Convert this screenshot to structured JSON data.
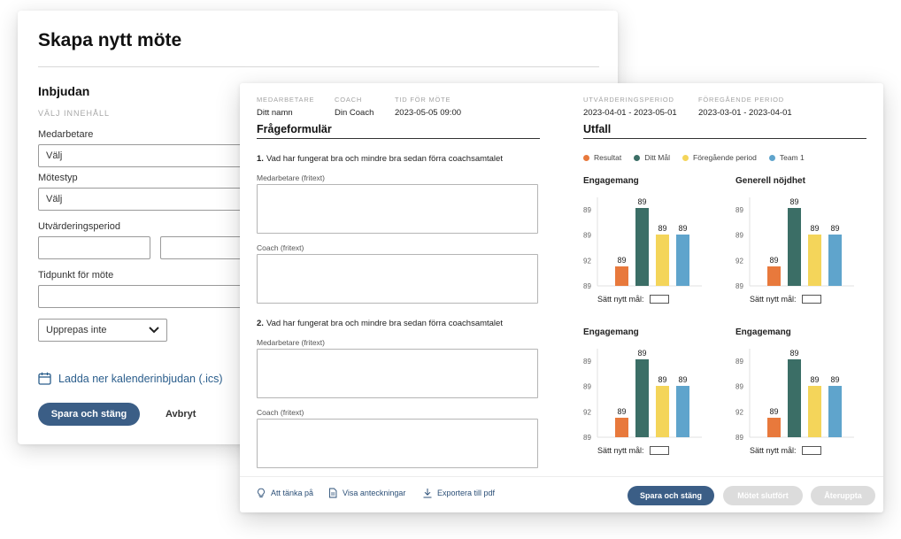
{
  "back_dialog": {
    "title": "Skapa nytt möte",
    "section_title": "Inbjudan",
    "section_caps": "VÄLJ INNEHÅLL",
    "fields": {
      "medarbetare_label": "Medarbetare",
      "medarbetare_value": "Välj",
      "motestyp_label": "Mötestyp",
      "motestyp_value": "Välj",
      "period_label": "Utvärderingsperiod",
      "tidpunkt_label": "Tidpunkt för möte"
    },
    "repeat_value": "Upprepas inte",
    "download_label": "Ladda ner kalenderinbjudan (.ics)",
    "save_label": "Spara och stäng",
    "cancel_label": "Avbryt"
  },
  "front_dialog": {
    "meta": [
      {
        "key": "MEDARBETARE",
        "value": "Ditt namn"
      },
      {
        "key": "COACH",
        "value": "Din Coach"
      },
      {
        "key": "TID FÖR MÖTE",
        "value": "2023-05-05 09:00"
      },
      {
        "key": "UTVÄRDERINGSPERIOD",
        "value": "2023-04-01 - 2023-05-01"
      },
      {
        "key": "FÖREGÅENDE PERIOD",
        "value": "2023-03-01 - 2023-04-01"
      }
    ],
    "form_title": "Frågeformulär",
    "questions": [
      {
        "num": "1.",
        "text": "Vad har fungerat bra och mindre bra sedan förra coachsamtalet",
        "employee_label": "Medarbetare (fritext)",
        "coach_label": "Coach (fritext)"
      },
      {
        "num": "2.",
        "text": "Vad har fungerat bra och mindre bra sedan förra coachsamtalet",
        "employee_label": "Medarbetare (fritext)",
        "coach_label": "Coach (fritext)"
      }
    ],
    "results_title": "Utfall",
    "legend": [
      {
        "label": "Resultat",
        "color": "#e8793c"
      },
      {
        "label": "Ditt Mål",
        "color": "#3b6e66"
      },
      {
        "label": "Föregående period",
        "color": "#f4d55a"
      },
      {
        "label": "Team 1",
        "color": "#5fa4cc"
      }
    ],
    "goal_label": "Sätt nytt mål:",
    "toolbar": {
      "think_label": "Att tänka på",
      "notes_label": "Visa anteckningar",
      "export_label": "Exportera till pdf"
    },
    "buttons": {
      "save_label": "Spara och stäng",
      "complete_label": "Mötet slutfört",
      "reopen_label": "Återuppta"
    }
  },
  "chart_data": [
    {
      "type": "bar",
      "title": "Engagemang",
      "y_tick_labels": [
        "89",
        "89",
        "92",
        "89"
      ],
      "categories": [
        "Resultat",
        "Ditt Mål",
        "Föregående period",
        "Team 1"
      ],
      "values": [
        89,
        89,
        89,
        89
      ],
      "bar_levels": [
        0.22,
        0.88,
        0.58,
        0.58
      ],
      "colors": [
        "#e8793c",
        "#3b6e66",
        "#f4d55a",
        "#5fa4cc"
      ]
    },
    {
      "type": "bar",
      "title": "Generell nöjdhet",
      "y_tick_labels": [
        "89",
        "89",
        "92",
        "89"
      ],
      "categories": [
        "Resultat",
        "Ditt Mål",
        "Föregående period",
        "Team 1"
      ],
      "values": [
        89,
        89,
        89,
        89
      ],
      "bar_levels": [
        0.22,
        0.88,
        0.58,
        0.58
      ],
      "colors": [
        "#e8793c",
        "#3b6e66",
        "#f4d55a",
        "#5fa4cc"
      ]
    },
    {
      "type": "bar",
      "title": "Engagemang",
      "y_tick_labels": [
        "89",
        "89",
        "92",
        "89"
      ],
      "categories": [
        "Resultat",
        "Ditt Mål",
        "Föregående period",
        "Team 1"
      ],
      "values": [
        89,
        89,
        89,
        89
      ],
      "bar_levels": [
        0.22,
        0.88,
        0.58,
        0.58
      ],
      "colors": [
        "#e8793c",
        "#3b6e66",
        "#f4d55a",
        "#5fa4cc"
      ]
    },
    {
      "type": "bar",
      "title": "Engagemang",
      "y_tick_labels": [
        "89",
        "89",
        "92",
        "89"
      ],
      "categories": [
        "Resultat",
        "Ditt Mål",
        "Föregående period",
        "Team 1"
      ],
      "values": [
        89,
        89,
        89,
        89
      ],
      "bar_levels": [
        0.22,
        0.88,
        0.58,
        0.58
      ],
      "colors": [
        "#e8793c",
        "#3b6e66",
        "#f4d55a",
        "#5fa4cc"
      ]
    }
  ]
}
